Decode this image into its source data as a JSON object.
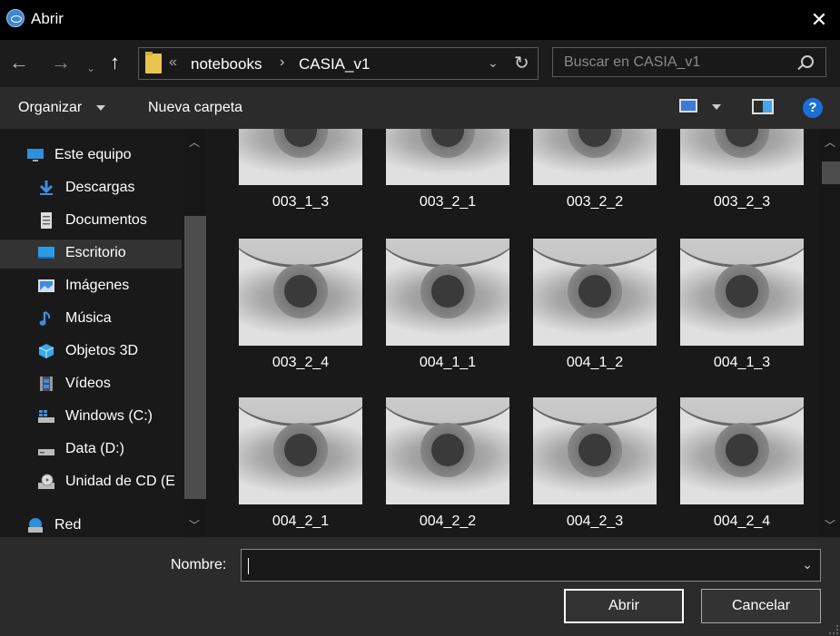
{
  "window": {
    "title": "Abrir"
  },
  "address": {
    "overflow": "«",
    "crumbs": [
      "notebooks",
      "CASIA_v1"
    ],
    "separator": "›"
  },
  "search": {
    "placeholder": "Buscar en CASIA_v1"
  },
  "toolbar": {
    "organize": "Organizar",
    "new_folder": "Nueva carpeta",
    "help": "?"
  },
  "nav": {
    "items": [
      {
        "label": "Este equipo",
        "icon": "computer-icon"
      },
      {
        "label": "Descargas",
        "icon": "download-icon"
      },
      {
        "label": "Documentos",
        "icon": "document-icon"
      },
      {
        "label": "Escritorio",
        "icon": "desktop-icon"
      },
      {
        "label": "Imágenes",
        "icon": "pictures-icon"
      },
      {
        "label": "Música",
        "icon": "music-icon"
      },
      {
        "label": "Objetos 3D",
        "icon": "objects3d-icon"
      },
      {
        "label": "Vídeos",
        "icon": "videos-icon"
      },
      {
        "label": "Windows (C:)",
        "icon": "windows-drive-icon"
      },
      {
        "label": "Data (D:)",
        "icon": "drive-icon"
      },
      {
        "label": "Unidad de CD (E",
        "icon": "cd-drive-icon"
      },
      {
        "label": "Red",
        "icon": "network-icon"
      }
    ]
  },
  "files": [
    "003_1_3",
    "003_2_1",
    "003_2_2",
    "003_2_3",
    "003_2_4",
    "004_1_1",
    "004_1_2",
    "004_1_3",
    "004_2_1",
    "004_2_2",
    "004_2_3",
    "004_2_4"
  ],
  "footer": {
    "name_label": "Nombre:",
    "name_value": "",
    "open_label": "Abrir",
    "cancel_label": "Cancelar"
  },
  "colors": {
    "accent": "#1a6fd6",
    "selected": "#333333",
    "folder": "#e8c54e"
  }
}
